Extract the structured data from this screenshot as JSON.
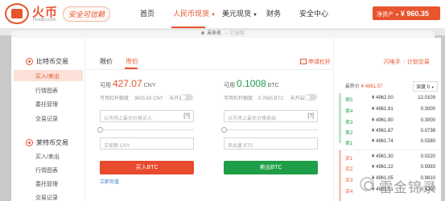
{
  "brand": {
    "name": "火币",
    "domain": "Huobi.com",
    "slogan": "安全可信赖"
  },
  "nav": [
    {
      "label": "首页"
    },
    {
      "label": "人民币现货"
    },
    {
      "label": "美元现货"
    },
    {
      "label": "财务"
    },
    {
      "label": "安全中心"
    }
  ],
  "assets": {
    "label": "净资产",
    "amount": "¥ 960.35"
  },
  "dialog": {
    "title": "未命名",
    "subtitle": "— 已编辑"
  },
  "sidebar": {
    "btc_section": "比特币交易",
    "btc_items": [
      "买入/卖出",
      "行情图表",
      "委托管理",
      "交易记录"
    ],
    "ltc_section": "莱特币交易",
    "ltc_items": [
      "买入/卖出",
      "行情图表",
      "委托管理",
      "交易记录"
    ]
  },
  "tabs": {
    "limit": "限价",
    "market": "市价"
  },
  "bonus": "申请杠杆",
  "buy": {
    "available_label": "可用",
    "available_value": "427.07",
    "available_unit": "CNY",
    "leverage_label": "可用杠杆额度",
    "leverage_value": "3805.63 CNY",
    "leverage_toggle": "未开启",
    "price_placeholder": "以市场上最优价格买入",
    "price_suffix": "[?]",
    "amount_placeholder": "交易额 CNY",
    "button": "买入BTC",
    "recharge": "立即充值"
  },
  "sell": {
    "available_label": "可用",
    "available_value": "0.1008",
    "available_unit": "BTC",
    "leverage_label": "可用杠杆额度",
    "leverage_value": "0.7665 BTC",
    "leverage_toggle": "未开启",
    "price_placeholder": "以市场上最优价格卖出",
    "price_suffix": "[?]",
    "amount_placeholder": "卖出量 BTC",
    "button": "卖出BTC"
  },
  "right_links": {
    "flash": "闪电手",
    "planned": "计划交易"
  },
  "orderbook": {
    "latest_label": "最新价",
    "latest_value": "¥ 4961.57",
    "depth_label": "深度",
    "depth_value": "0",
    "asks": [
      {
        "label": "卖5",
        "price": "¥ 4962.00",
        "amount": "12.0109"
      },
      {
        "label": "卖4",
        "price": "¥ 4961.91",
        "amount": "0.3000"
      },
      {
        "label": "卖3",
        "price": "¥ 4961.90",
        "amount": "0.3000"
      },
      {
        "label": "卖2",
        "price": "¥ 4961.87",
        "amount": "0.0738"
      },
      {
        "label": "卖1",
        "price": "¥ 4961.74",
        "amount": "0.0280"
      }
    ],
    "bids": [
      {
        "label": "买1",
        "price": "¥ 4961.30",
        "amount": "0.0220"
      },
      {
        "label": "买2",
        "price": "¥ 4961.22",
        "amount": "0.5993"
      },
      {
        "label": "买3",
        "price": "¥ 4961.05",
        "amount": "0.9810"
      },
      {
        "label": "买4",
        "price": "¥ 4961.01",
        "amount": "0.4200"
      }
    ]
  },
  "watermark": "雷金锦录"
}
